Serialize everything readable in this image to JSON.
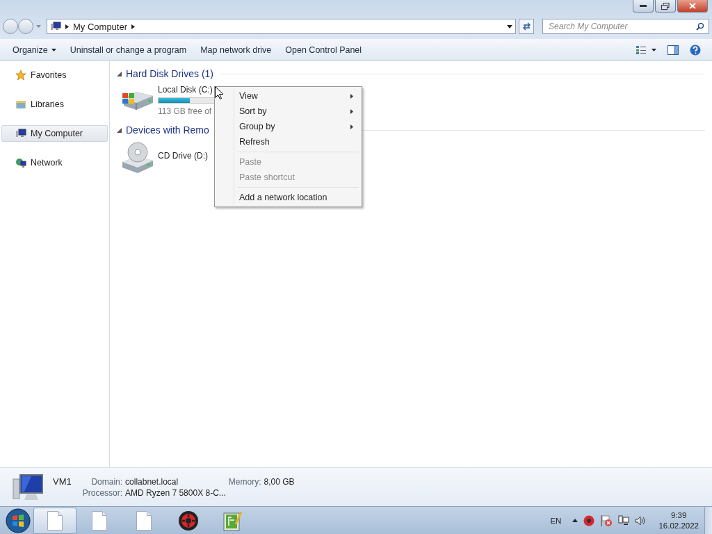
{
  "address": {
    "path": "My Computer",
    "search": {
      "placeholder": "Search My Computer"
    }
  },
  "toolbar": {
    "items": [
      {
        "label": "Organize",
        "dropdown": true
      },
      {
        "label": "Uninstall or change a program",
        "dropdown": false
      },
      {
        "label": "Map network drive",
        "dropdown": false
      },
      {
        "label": "Open Control Panel",
        "dropdown": false
      }
    ]
  },
  "sidebar": {
    "items": [
      {
        "kind": "favorites",
        "label": "Favorites",
        "selected": false
      },
      {
        "kind": "libraries",
        "label": "Libraries",
        "selected": false
      },
      {
        "kind": "computer",
        "label": "My Computer",
        "selected": true
      },
      {
        "kind": "network",
        "label": "Network",
        "selected": false
      }
    ]
  },
  "groups": [
    {
      "title": "Hard Disk Drives (1)",
      "expanded": true,
      "items": [
        {
          "kind": "hdd",
          "name": "Local Disk (C:)",
          "level": 0.24,
          "free": "113 GB free of"
        }
      ]
    },
    {
      "title": "Devices with Remo",
      "expanded": true,
      "items": [
        {
          "kind": "cd",
          "name": "CD Drive (D:)"
        }
      ]
    }
  ],
  "context_menu": {
    "sections": [
      [
        {
          "label": "View",
          "submenu": true,
          "disabled": false
        },
        {
          "label": "Sort by",
          "submenu": true,
          "disabled": false
        },
        {
          "label": "Group by",
          "submenu": true,
          "disabled": false
        },
        {
          "label": "Refresh",
          "submenu": false,
          "disabled": false
        }
      ],
      [
        {
          "label": "Paste",
          "submenu": false,
          "disabled": true
        },
        {
          "label": "Paste shortcut",
          "submenu": false,
          "disabled": true
        }
      ],
      [
        {
          "label": "Add a network location",
          "submenu": false,
          "disabled": false
        }
      ]
    ]
  },
  "details": {
    "name": "VM1",
    "fields": [
      {
        "label": "Domain:",
        "value": "collabnet.local"
      },
      {
        "label": "Memory:",
        "value": "8,00 GB"
      },
      {
        "label": "Processor:",
        "value": "AMD Ryzen 7 5800X 8-C..."
      }
    ]
  },
  "taskbar": {
    "apps": [
      {
        "kind": "document",
        "selected": true
      },
      {
        "kind": "document",
        "selected": false
      },
      {
        "kind": "document",
        "selected": false
      },
      {
        "kind": "gear",
        "selected": false
      },
      {
        "kind": "notepad",
        "selected": false
      }
    ],
    "language": "EN",
    "time": "9:39",
    "date": "16.02.2022"
  }
}
